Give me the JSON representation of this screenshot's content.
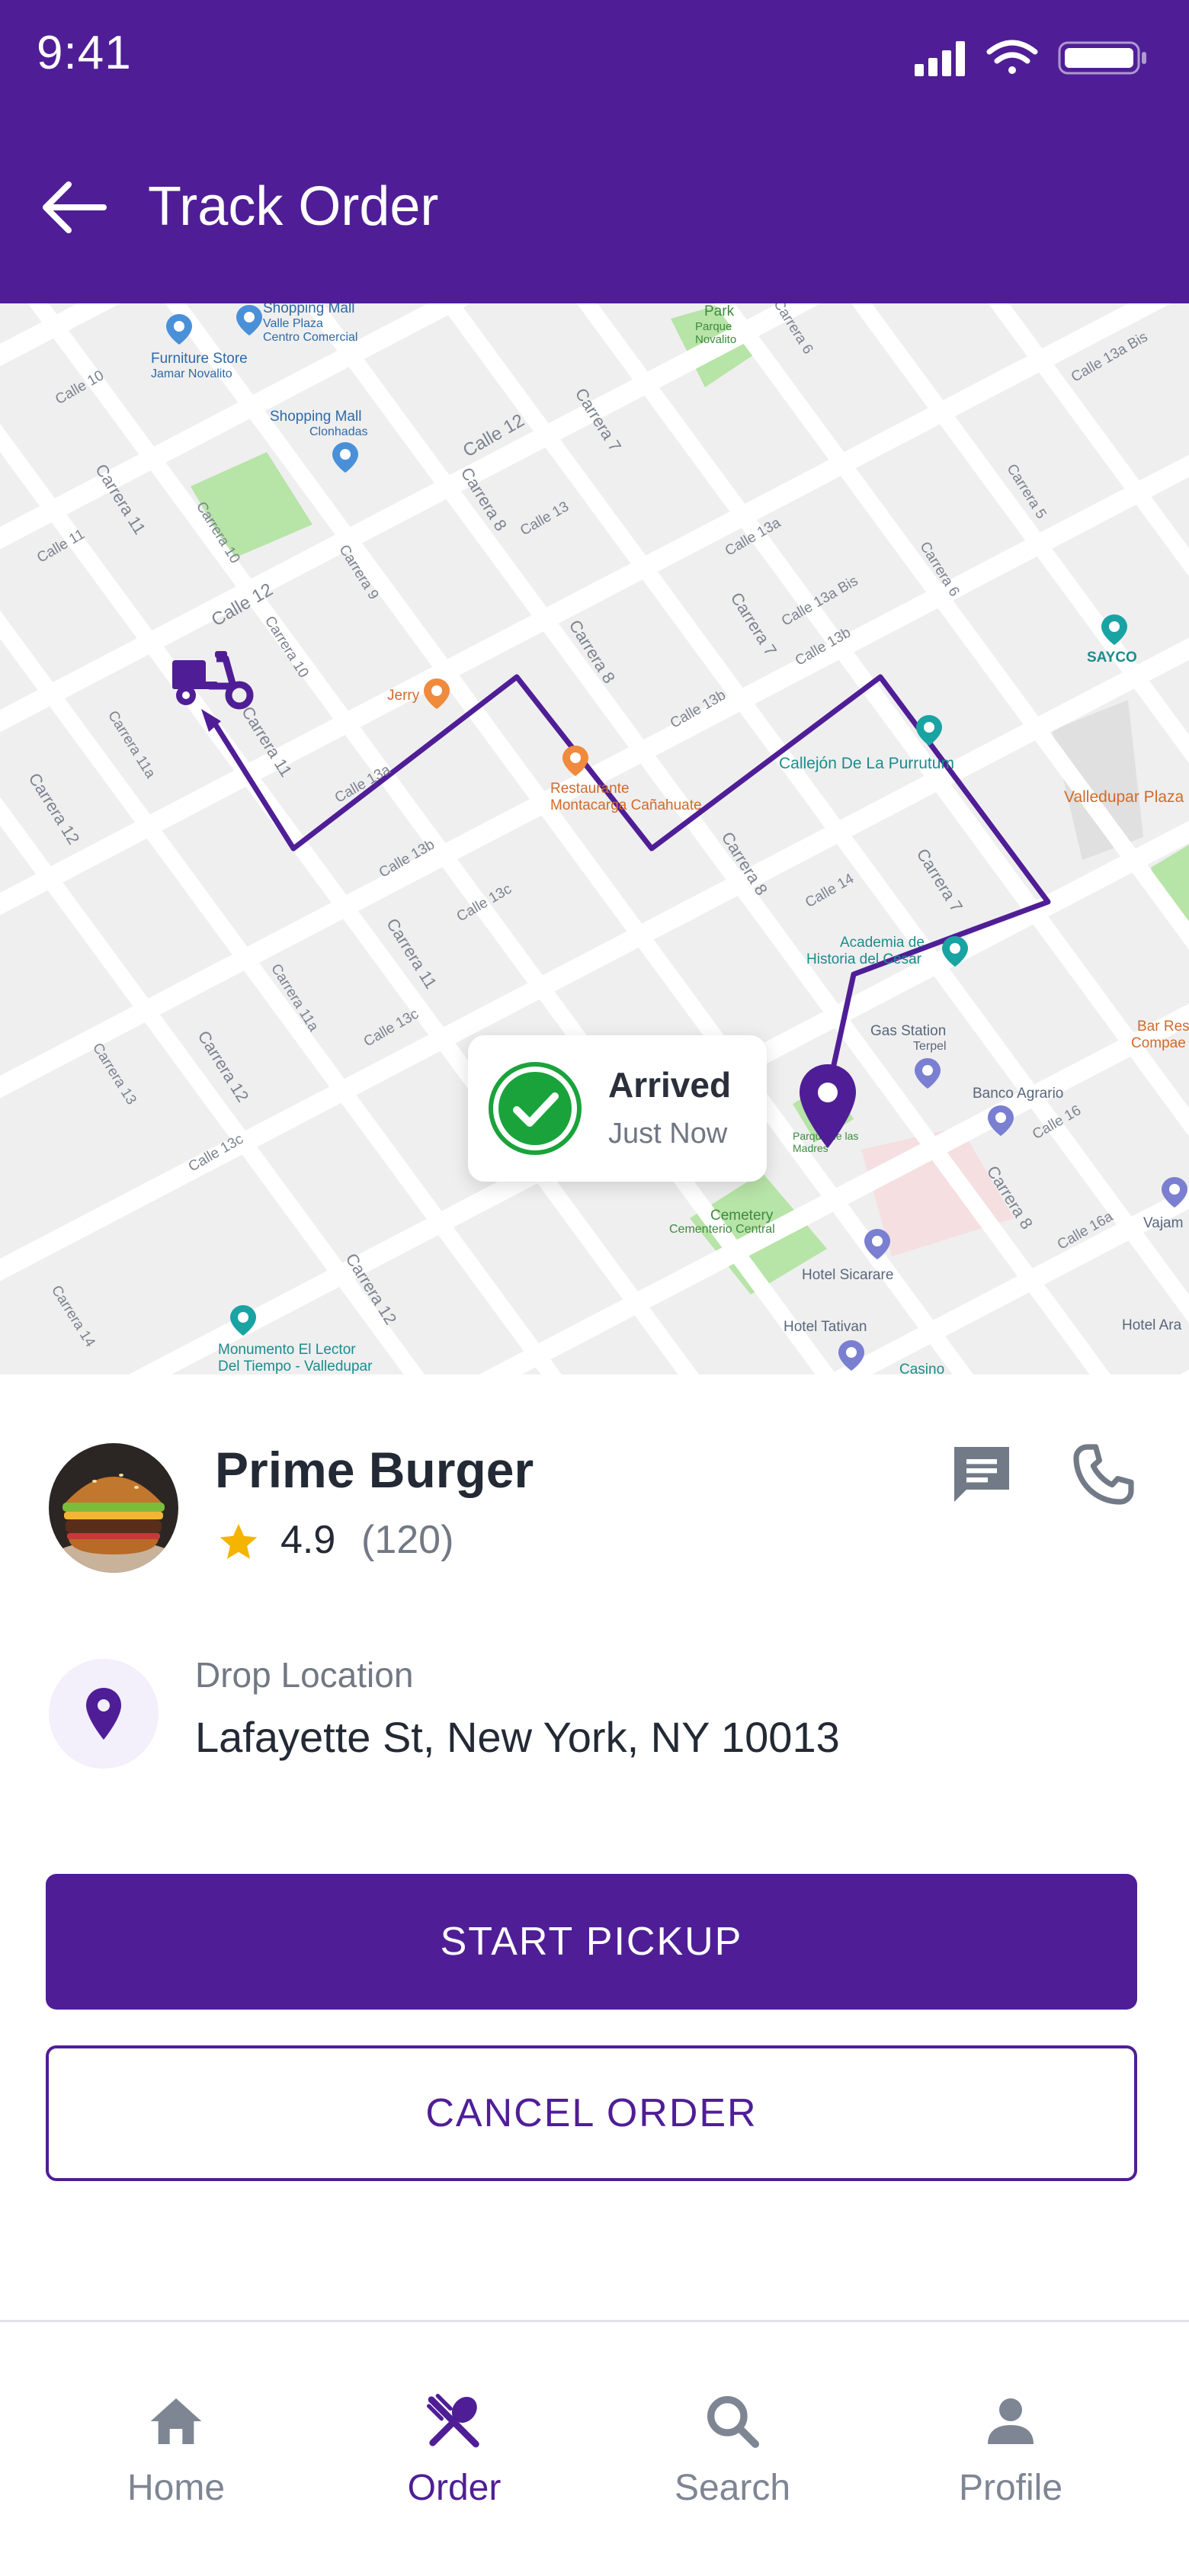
{
  "status_bar": {
    "time": "9:41"
  },
  "header": {
    "title": "Track Order",
    "back_icon": "arrow-left-icon"
  },
  "map": {
    "status_card": {
      "title": "Arrived",
      "subtitle": "Just Now",
      "icon": "check-circle-icon"
    },
    "labels": {
      "shopping_mall_top": "Shopping Mall",
      "valle_plaza": "Valle Plaza",
      "centro_comercial": "Centro Comercial",
      "furniture_store": "Furniture Store",
      "jamar_novalito": "Jamar Novalito",
      "park": "Park",
      "parque_novalito": "Parque Novalito",
      "shopping_mall": "Shopping Mall",
      "clonhadas": "Clonhadas",
      "sayco": "SAYCO",
      "jerry": "Jerry",
      "restaurante": "Restaurante",
      "montacarga": "Montacarga Cañahuate",
      "callejon": "Callejón De La Purrutum",
      "valledupar_plaza": "Valledupar Plaza",
      "academia": "Academia de",
      "historia": "Historia del Cesar",
      "gas_station": "Gas Station",
      "terpel": "Terpel",
      "banco_agrario": "Banco Agrario",
      "bar_rest": "Bar Res",
      "compae": "Compae",
      "parque_madres": "Parque de las Madres",
      "cemetery": "Cemetery",
      "cementerio_central": "Cementerio Central",
      "hotel_sicarare": "Hotel Sicarare",
      "hotel_tativan": "Hotel Tativan",
      "casino": "Casino",
      "vajama": "Vajam",
      "hotel_ara": "Hotel Ara",
      "monumento": "Monumento El Lector",
      "del_tiempo": "Del Tiempo - Valledupar",
      "calle_10": "Calle 10",
      "calle_11": "Calle 11",
      "calle_12a": "Calle 12",
      "calle_12b": "Calle 12",
      "calle_13": "Calle 13",
      "calle_13a": "Calle 13a",
      "calle_13b": "Calle 13b",
      "calle_13bis": "Calle 13a Bis",
      "calle_13c": "Calle 13c",
      "calle_14": "Calle 14",
      "calle_16": "Calle 16",
      "calle_16a": "Calle 16a",
      "carrera_5": "Carrera 5",
      "carrera_6": "Carrera 6",
      "carrera_7a": "Carrera 7",
      "carrera_7b": "Carrera 7",
      "carrera_7c": "Carrera 7",
      "carrera_8a": "Carrera 8",
      "carrera_8b": "Carrera 8",
      "carrera_8c": "Carrera 8",
      "carrera_8d": "Carrera 8",
      "carrera_9": "Carrera 9",
      "carrera_10a": "Carrera 10",
      "carrera_10b": "Carrera 10",
      "carrera_11a": "Carrera 11",
      "carrera_11b": "Carrera 11",
      "carrera_11c": "Carrera 11",
      "carrera_11d": "Carrera 11a",
      "carrera_11e": "Carrera 11a",
      "carrera_12a": "Carrera 12",
      "carrera_12b": "Carrera 12",
      "carrera_12c": "Carrera 12",
      "carrera_13": "Carrera 13",
      "carrera_14": "Carrera 14"
    }
  },
  "restaurant": {
    "name": "Prime Burger",
    "rating": "4.9",
    "rating_count": "(120)",
    "chat_icon": "message-icon",
    "phone_icon": "phone-icon"
  },
  "drop": {
    "label": "Drop Location",
    "address": "Lafayette St, New York, NY 10013"
  },
  "actions": {
    "primary": "START PICKUP",
    "secondary": "CANCEL ORDER"
  },
  "tabs": [
    {
      "label": "Home",
      "icon": "home-icon",
      "active": false
    },
    {
      "label": "Order",
      "icon": "utensils-icon",
      "active": true
    },
    {
      "label": "Search",
      "icon": "search-icon",
      "active": false
    },
    {
      "label": "Profile",
      "icon": "person-icon",
      "active": false
    }
  ],
  "colors": {
    "brand": "#4f1e96",
    "star": "#f5b400",
    "success": "#1aa33b"
  }
}
